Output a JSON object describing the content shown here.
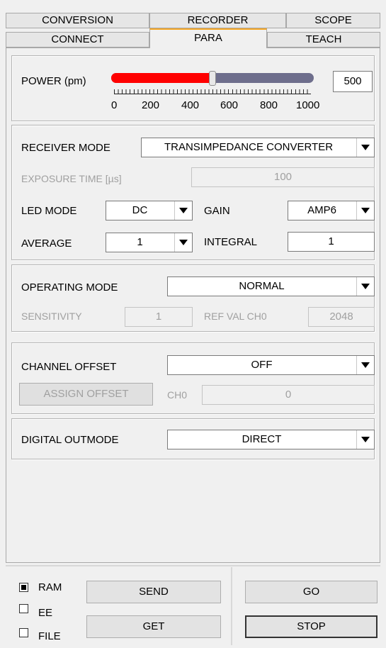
{
  "tabs_row1": [
    "CONVERSION",
    "RECORDER",
    "SCOPE"
  ],
  "tabs_row2": [
    "CONNECT",
    "PARA",
    "TEACH"
  ],
  "active_tab": "PARA",
  "power": {
    "label": "POWER (pm)",
    "value": "500",
    "slider_fraction": 0.5,
    "ticks": [
      "0",
      "200",
      "400",
      "600",
      "800",
      "1000"
    ],
    "fill_color": "#ff0000",
    "track_color": "#6e6e8c"
  },
  "receiver": {
    "mode_label": "RECEIVER MODE",
    "mode_value": "TRANSIMPEDANCE CONVERTER",
    "exposure_label": "EXPOSURE TIME [µs]",
    "exposure_value": "100",
    "led_label": "LED MODE",
    "led_value": "DC",
    "gain_label": "GAIN",
    "gain_value": "AMP6",
    "average_label": "AVERAGE",
    "average_value": "1",
    "integral_label": "INTEGRAL",
    "integral_value": "1"
  },
  "operating": {
    "mode_label": "OPERATING MODE",
    "mode_value": "NORMAL",
    "sensitivity_label": "SENSITIVITY",
    "sensitivity_value": "1",
    "refval_label": "REF VAL CH0",
    "refval_value": "2048"
  },
  "offset": {
    "label": "CHANNEL OFFSET",
    "value": "OFF",
    "assign_label": "ASSIGN OFFSET",
    "ch_label": "CH0",
    "ch_value": "0"
  },
  "digital": {
    "label": "DIGITAL OUTMODE",
    "value": "DIRECT"
  },
  "bottom": {
    "ram_label": "RAM",
    "ee_label": "EE",
    "file_label": "FILE",
    "ram_checked": true,
    "ee_checked": false,
    "file_checked": false,
    "send_label": "SEND",
    "get_label": "GET",
    "go_label": "GO",
    "stop_label": "STOP"
  }
}
